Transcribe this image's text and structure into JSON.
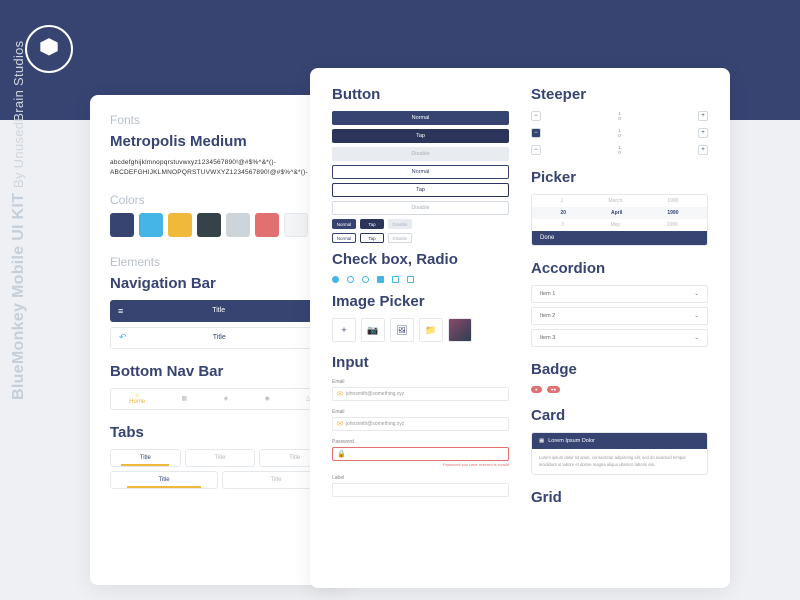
{
  "brand": {
    "title": "BlueMonkey Mobile UI KIT",
    "by": "By UnusedBrain Studios"
  },
  "fonts": {
    "heading": "Fonts",
    "family": "Metropolis Medium",
    "charset1": "abcdefghijklmnopqrstuvwxyz1234567890!@#$%^&*()-",
    "charset2": "ABCDEFGHIJKLMNOPQRSTUVWXYZ1234567890!@#$%^&*()-"
  },
  "colors": {
    "heading": "Colors",
    "palette": [
      "#374472",
      "#45B5E6",
      "#F0B93A",
      "#36424A",
      "#CDD4DA",
      "#E27070",
      "#F3F4F6"
    ]
  },
  "elements": {
    "heading": "Elements"
  },
  "navbar": {
    "heading": "Navigation Bar",
    "title": "Title"
  },
  "bottomnav": {
    "heading": "Bottom Nav Bar",
    "items": [
      "Home",
      "",
      "",
      "",
      ""
    ]
  },
  "tabs": {
    "heading": "Tabs",
    "items": [
      "Title",
      "Title",
      "Title"
    ]
  },
  "button": {
    "heading": "Button",
    "normal": "Normal",
    "tap": "Tap",
    "disable": "Disable"
  },
  "checkbox": {
    "heading": "Check box, Radio"
  },
  "imagepicker": {
    "heading": "Image Picker"
  },
  "input": {
    "heading": "Input",
    "email_label": "Email",
    "email_ph": "johnsmith@something.xyz",
    "pwd_label": "Password",
    "pwd_err": "Password you have entered is invalid",
    "label_label": "Label"
  },
  "steeper": {
    "heading": "Steeper",
    "vals": [
      {
        "a": "1",
        "b": "0"
      },
      {
        "a": "1",
        "b": "0"
      },
      {
        "a": "1",
        "b": "0"
      }
    ]
  },
  "picker": {
    "heading": "Picker",
    "rows": [
      [
        "1",
        "March",
        "1990"
      ],
      [
        "20",
        "April",
        "1990"
      ],
      [
        "3",
        "May",
        "1990"
      ]
    ],
    "done": "Done"
  },
  "accordion": {
    "heading": "Accordion",
    "items": [
      "Item 1",
      "Item 2",
      "Item 3"
    ]
  },
  "badge": {
    "heading": "Badge"
  },
  "card": {
    "heading": "Card",
    "title": "Lorem Ipsum Dolor",
    "body": "Lorem ipsum dolor sit amet, consectetur adipiscing elit, sed do eiusmod tempor incididunt ut labore et dolore magna aliqua ullamco laboris nisi."
  },
  "grid": {
    "heading": "Grid"
  }
}
